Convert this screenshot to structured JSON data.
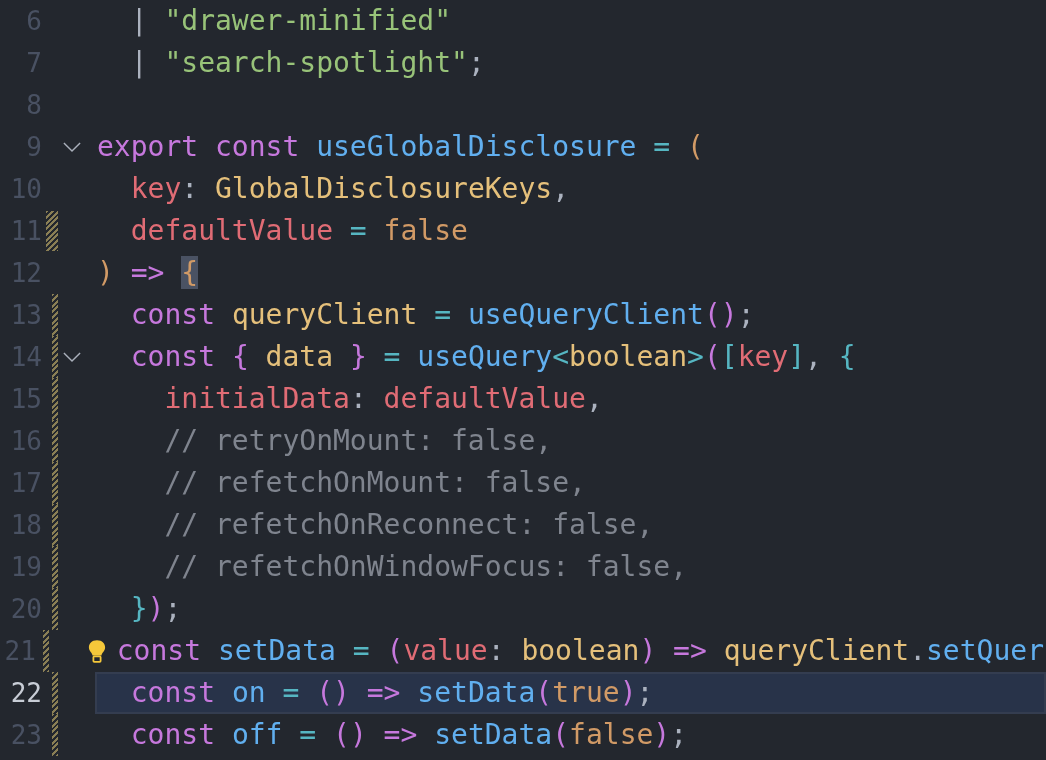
{
  "editor": {
    "lines": [
      {
        "number": "6",
        "kind": "plain",
        "selected": false,
        "fold": false,
        "lightbulb": false,
        "tokens": [
          {
            "text": "  | ",
            "kind": "punct"
          },
          {
            "text": "\"drawer-minified\"",
            "kind": "str"
          }
        ]
      },
      {
        "number": "7",
        "kind": "plain",
        "selected": false,
        "fold": false,
        "lightbulb": false,
        "tokens": [
          {
            "text": "  | ",
            "kind": "punct"
          },
          {
            "text": "\"search-spotlight\"",
            "kind": "str"
          },
          {
            "text": ";",
            "kind": "punct"
          }
        ]
      },
      {
        "number": "8",
        "kind": "plain",
        "selected": false,
        "fold": false,
        "lightbulb": false
      },
      {
        "number": "9",
        "kind": "plain",
        "selected": false,
        "fold": true,
        "lightbulb": false,
        "tokens": [
          {
            "text": "export const ",
            "kind": "kw"
          },
          {
            "text": "useGlobalDisclosure",
            "kind": "fn"
          },
          {
            "text": " = ",
            "kind": "op"
          },
          {
            "text": "(",
            "kind": "paren"
          }
        ]
      },
      {
        "number": "10",
        "kind": "plain",
        "selected": false,
        "fold": false,
        "lightbulb": false,
        "tokens": [
          {
            "text": "  key",
            "kind": "var"
          },
          {
            "text": ": ",
            "kind": "punct"
          },
          {
            "text": "GlobalDisclosureKeys",
            "kind": "type"
          },
          {
            "text": ",",
            "kind": "punct"
          }
        ]
      },
      {
        "number": "11",
        "kind": "modified",
        "selected": false,
        "fold": false,
        "lightbulb": false,
        "tokens": [
          {
            "text": "  defaultValue",
            "kind": "var"
          },
          {
            "text": " = ",
            "kind": "op"
          },
          {
            "text": "false",
            "kind": "lit"
          }
        ]
      },
      {
        "number": "12",
        "kind": "plain",
        "selected": false,
        "fold": false,
        "lightbulb": false,
        "tokens": [
          {
            "text": ") ",
            "kind": "paren"
          },
          {
            "text": "=> ",
            "kind": "kw"
          },
          {
            "text": "{",
            "kind": "match"
          }
        ]
      },
      {
        "number": "13",
        "kind": "added",
        "selected": false,
        "fold": false,
        "lightbulb": false,
        "tokens": [
          {
            "text": "  const ",
            "kind": "kw"
          },
          {
            "text": "queryClient",
            "kind": "type"
          },
          {
            "text": " = ",
            "kind": "op"
          },
          {
            "text": "useQueryClient",
            "kind": "fn"
          },
          {
            "text": "()",
            "kind": "kw"
          },
          {
            "text": ";",
            "kind": "punct"
          }
        ]
      },
      {
        "number": "14",
        "kind": "added",
        "selected": false,
        "fold": true,
        "lightbulb": false,
        "tokens": [
          {
            "text": "  const ",
            "kind": "kw"
          },
          {
            "text": "{ ",
            "kind": "kw"
          },
          {
            "text": "data",
            "kind": "type"
          },
          {
            "text": " } ",
            "kind": "kw"
          },
          {
            "text": "= ",
            "kind": "op"
          },
          {
            "text": "useQuery",
            "kind": "fn"
          },
          {
            "text": "<",
            "kind": "op"
          },
          {
            "text": "boolean",
            "kind": "type"
          },
          {
            "text": ">",
            "kind": "op"
          },
          {
            "text": "(",
            "kind": "kw"
          },
          {
            "text": "[",
            "kind": "op"
          },
          {
            "text": "key",
            "kind": "var"
          },
          {
            "text": "]",
            "kind": "op"
          },
          {
            "text": ", ",
            "kind": "punct"
          },
          {
            "text": "{",
            "kind": "op"
          }
        ]
      },
      {
        "number": "15",
        "kind": "added",
        "selected": false,
        "fold": false,
        "lightbulb": false,
        "tokens": [
          {
            "text": "    initialData",
            "kind": "var"
          },
          {
            "text": ": ",
            "kind": "punct"
          },
          {
            "text": "defaultValue",
            "kind": "var"
          },
          {
            "text": ",",
            "kind": "punct"
          }
        ]
      },
      {
        "number": "16",
        "kind": "added",
        "selected": false,
        "fold": false,
        "lightbulb": false,
        "tokens": [
          {
            "text": "    // retryOnMount: false,",
            "kind": "com"
          }
        ]
      },
      {
        "number": "17",
        "kind": "added",
        "selected": false,
        "fold": false,
        "lightbulb": false,
        "tokens": [
          {
            "text": "    // refetchOnMount: false,",
            "kind": "com"
          }
        ]
      },
      {
        "number": "18",
        "kind": "added",
        "selected": false,
        "fold": false,
        "lightbulb": false,
        "tokens": [
          {
            "text": "    // refetchOnReconnect: false,",
            "kind": "com"
          }
        ]
      },
      {
        "number": "19",
        "kind": "added",
        "selected": false,
        "fold": false,
        "lightbulb": false,
        "tokens": [
          {
            "text": "    // refetchOnWindowFocus: false,",
            "kind": "com"
          }
        ]
      },
      {
        "number": "20",
        "kind": "added",
        "selected": false,
        "fold": false,
        "lightbulb": false,
        "tokens": [
          {
            "text": "  }",
            "kind": "op"
          },
          {
            "text": ")",
            "kind": "kw"
          },
          {
            "text": ";",
            "kind": "punct"
          }
        ]
      },
      {
        "number": "21",
        "kind": "added",
        "selected": false,
        "fold": false,
        "lightbulb": true,
        "tokens": [
          {
            "text": "  const ",
            "kind": "kw"
          },
          {
            "text": "setData",
            "kind": "fn"
          },
          {
            "text": " = ",
            "kind": "op"
          },
          {
            "text": "(",
            "kind": "kw"
          },
          {
            "text": "value",
            "kind": "var"
          },
          {
            "text": ": ",
            "kind": "punct"
          },
          {
            "text": "boolean",
            "kind": "type"
          },
          {
            "text": ") => ",
            "kind": "kw"
          },
          {
            "text": "queryClient",
            "kind": "type"
          },
          {
            "text": ".",
            "kind": "punct"
          },
          {
            "text": "setQuer",
            "kind": "fn"
          }
        ]
      },
      {
        "number": "22",
        "kind": "added",
        "selected": true,
        "fold": false,
        "lightbulb": false,
        "tokens": [
          {
            "text": "  const ",
            "kind": "kw"
          },
          {
            "text": "on",
            "kind": "fn"
          },
          {
            "text": " = ",
            "kind": "op"
          },
          {
            "text": "() => ",
            "kind": "kw"
          },
          {
            "text": "setData",
            "kind": "fn"
          },
          {
            "text": "(",
            "kind": "kw"
          },
          {
            "text": "true",
            "kind": "lit"
          },
          {
            "text": ")",
            "kind": "kw"
          },
          {
            "text": ";",
            "kind": "punct"
          }
        ]
      },
      {
        "number": "23",
        "kind": "added",
        "selected": false,
        "fold": false,
        "lightbulb": false,
        "tokens": [
          {
            "text": "  const ",
            "kind": "kw"
          },
          {
            "text": "off",
            "kind": "fn"
          },
          {
            "text": " = ",
            "kind": "op"
          },
          {
            "text": "() => ",
            "kind": "kw"
          },
          {
            "text": "setData",
            "kind": "fn"
          },
          {
            "text": "(",
            "kind": "kw"
          },
          {
            "text": "false",
            "kind": "lit"
          },
          {
            "text": ")",
            "kind": "kw"
          },
          {
            "text": ";",
            "kind": "punct"
          }
        ]
      }
    ]
  }
}
